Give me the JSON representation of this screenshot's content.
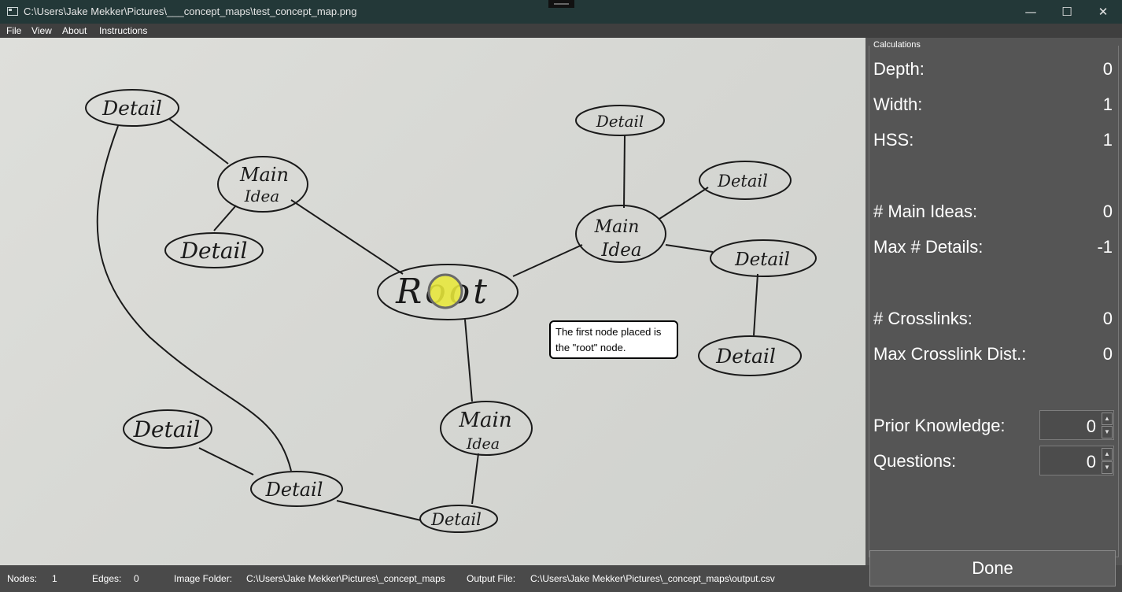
{
  "window": {
    "title": "C:\\Users\\Jake Mekker\\Pictures\\___concept_maps\\test_concept_map.png",
    "minimize_glyph": "—",
    "maximize_glyph": "☐",
    "close_glyph": "✕"
  },
  "menu": {
    "file": "File",
    "view": "View",
    "about": "About",
    "instructions": "Instructions"
  },
  "map": {
    "nodes": {
      "detail_tl": "Detail",
      "main_tl_1": "Main",
      "main_tl_2": "Idea",
      "detail_l": "Detail",
      "root": "Root",
      "detail_tr_top": "Detail",
      "main_r_1": "Main",
      "main_r_2": "Idea",
      "detail_r_1": "Detail",
      "detail_r_2": "Detail",
      "detail_r_3": "Detail",
      "main_b_1": "Main",
      "main_b_2": "Idea",
      "detail_bl": "Detail",
      "detail_bl2": "Detail",
      "detail_b": "Detail"
    },
    "marker_color": "#e8e83a"
  },
  "tooltip": {
    "line1": "The first node placed is",
    "line2": "the \"root\" node."
  },
  "calculations": {
    "title": "Calculations",
    "depth_label": "Depth:",
    "depth_value": "0",
    "width_label": "Width:",
    "width_value": "1",
    "hss_label": "HSS:",
    "hss_value": "1",
    "main_ideas_label": "# Main Ideas:",
    "main_ideas_value": "0",
    "max_details_label": "Max # Details:",
    "max_details_value": "-1",
    "crosslinks_label": "# Crosslinks:",
    "crosslinks_value": "0",
    "max_crosslink_label": "Max Crosslink Dist.:",
    "max_crosslink_value": "0",
    "prior_knowledge_label": "Prior Knowledge:",
    "prior_knowledge_value": "0",
    "questions_label": "Questions:",
    "questions_value": "0"
  },
  "done_label": "Done",
  "status": {
    "nodes_label": "Nodes:",
    "nodes_value": "1",
    "edges_label": "Edges:",
    "edges_value": "0",
    "image_folder_label": "Image Folder:",
    "image_folder_value": "C:\\Users\\Jake Mekker\\Pictures\\_concept_maps",
    "output_file_label": "Output File:",
    "output_file_value": "C:\\Users\\Jake Mekker\\Pictures\\_concept_maps\\output.csv"
  }
}
